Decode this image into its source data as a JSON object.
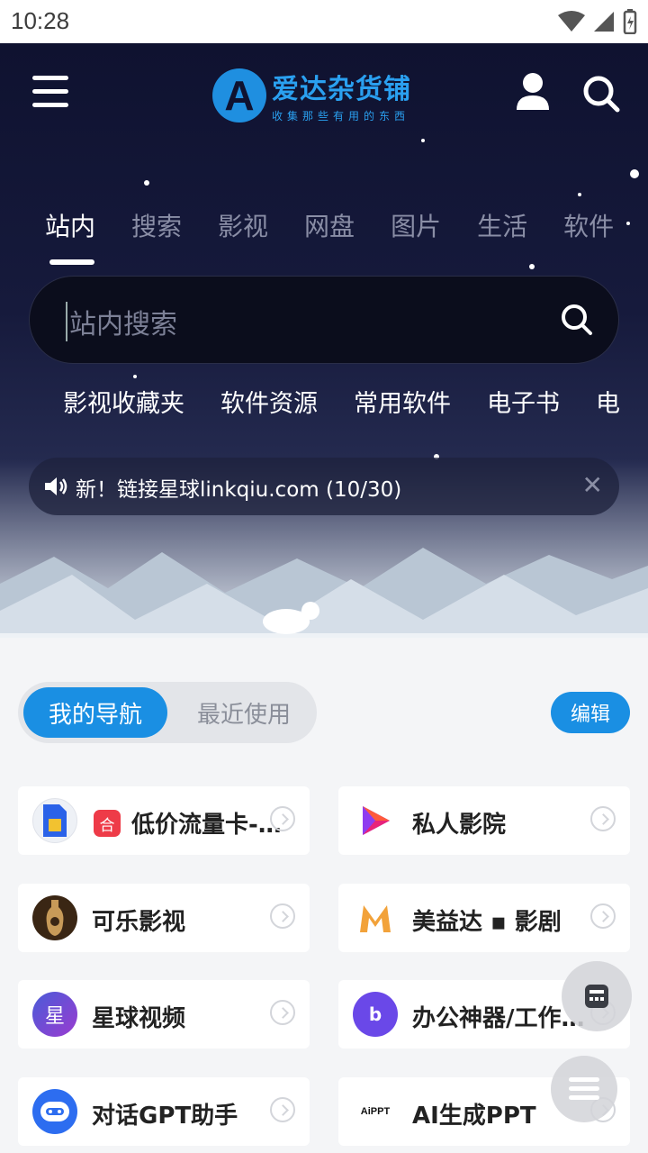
{
  "status": {
    "time": "10:28"
  },
  "header": {
    "logo_letter": "A",
    "site_name": "爱达杂货铺",
    "tagline": "收集那些有用的东西"
  },
  "tabs": [
    "站内",
    "搜索",
    "影视",
    "网盘",
    "图片",
    "生活",
    "软件"
  ],
  "search": {
    "placeholder": "站内搜索"
  },
  "quick_links": [
    "影视收藏夹",
    "软件资源",
    "常用软件",
    "电子书",
    "电"
  ],
  "notice": {
    "text": "新！链接星球linkqiu.com (10/30)",
    "close": "✕"
  },
  "nav": {
    "mine": "我的导航",
    "recent": "最近使用",
    "edit": "编辑"
  },
  "cards": [
    {
      "label": "低价流量卡-…",
      "badge": "合",
      "icon": "sim-card-icon"
    },
    {
      "label": "私人影院",
      "icon": "play-logo-icon"
    },
    {
      "label": "可乐影视",
      "icon": "cola-bottle-icon"
    },
    {
      "label": "美益达 ▪ 影剧",
      "icon": "m-logo-icon"
    },
    {
      "label": "星球视频",
      "icon_text": "星",
      "icon": "star-planet-icon"
    },
    {
      "label": "办公神器/工作…",
      "icon_text": "b",
      "icon": "book-icon"
    },
    {
      "label": "对话GPT助手",
      "icon": "chat-bot-icon"
    },
    {
      "label": "AI生成PPT",
      "icon_text": "AiPPT",
      "icon": "aippt-icon"
    }
  ],
  "colors": {
    "accent": "#1a8fe3",
    "hero_bg": "#0f1230"
  }
}
